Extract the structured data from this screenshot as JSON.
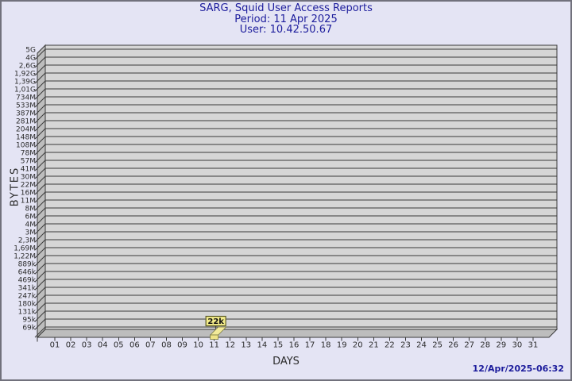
{
  "header": {
    "title": "SARG, Squid User Access Reports",
    "period": "Period: 11 Apr 2025",
    "user": "User: 10.42.50.67"
  },
  "footer": {
    "timestamp": "12/Apr/2025-06:32"
  },
  "chart_data": {
    "type": "bar",
    "title": "SARG, Squid User Access Reports",
    "subtitle_period": "Period: 11 Apr 2025",
    "subtitle_user": "User: 10.42.50.67",
    "xlabel": "DAYS",
    "ylabel": "BYTES",
    "y_scale": "logarithmic",
    "grid": "horizontal",
    "legend_position": "none",
    "x_categories": [
      "01",
      "02",
      "03",
      "04",
      "05",
      "06",
      "07",
      "08",
      "09",
      "10",
      "11",
      "12",
      "13",
      "14",
      "15",
      "16",
      "17",
      "18",
      "19",
      "20",
      "21",
      "22",
      "23",
      "24",
      "25",
      "26",
      "27",
      "28",
      "29",
      "30",
      "31"
    ],
    "y_tick_labels": [
      "5G",
      "4G",
      "2,6G",
      "1,92G",
      "1,39G",
      "1,01G",
      "734M",
      "533M",
      "387M",
      "281M",
      "204M",
      "148M",
      "108M",
      "78M",
      "57M",
      "41M",
      "30M",
      "22M",
      "16M",
      "11M",
      "8M",
      "6M",
      "4M",
      "3M",
      "2,3M",
      "1,69M",
      "1,22M",
      "889k",
      "646k",
      "469k",
      "341k",
      "247k",
      "180k",
      "131k",
      "95k",
      "69k"
    ],
    "bars": [
      {
        "day": "11",
        "value_label": "22k"
      }
    ],
    "colors": {
      "background": "#e4e4f4",
      "panel": "#d6d6d6",
      "wall": "#bdbdbd",
      "grid": "#3a3a3a",
      "axis_text": "#2b2b2b",
      "title_text": "#1c1c9c",
      "bar_fill": "#f2ea9a",
      "bar_fill_front": "#eee388",
      "bar_edge": "#77773d",
      "bar_label_bg": "#f3ec8a",
      "bar_label_border": "#5c5c28"
    }
  }
}
